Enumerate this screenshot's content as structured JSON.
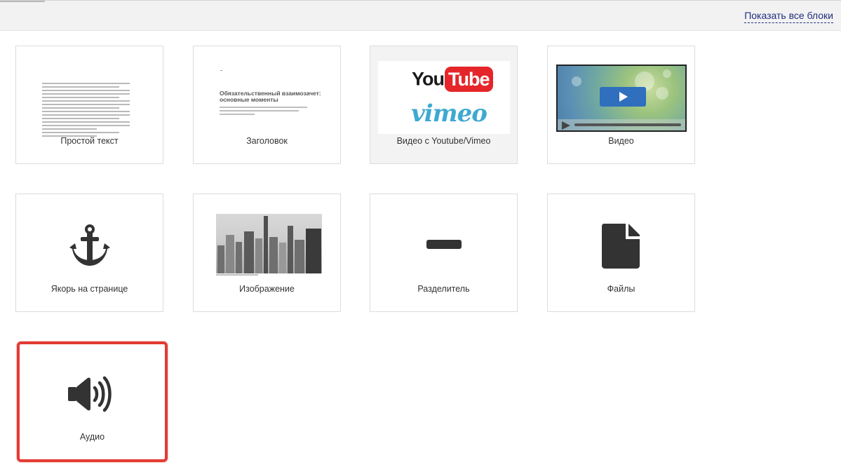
{
  "header": {
    "show_all_label": "Показать все блоки"
  },
  "blocks": [
    {
      "label": "Простой текст",
      "icon": "text-preview-icon"
    },
    {
      "label": "Заголовок",
      "icon": "heading-preview-icon"
    },
    {
      "label": "Видео с Youtube/Vimeo",
      "icon": "youtube-vimeo-logo",
      "state": "hovered"
    },
    {
      "label": "Видео",
      "icon": "video-player-preview"
    },
    {
      "label": "Якорь на странице",
      "icon": "anchor-icon"
    },
    {
      "label": "Изображение",
      "icon": "image-preview"
    },
    {
      "label": "Разделитель",
      "icon": "divider-icon"
    },
    {
      "label": "Файлы",
      "icon": "file-icon"
    },
    {
      "label": "Аудио",
      "icon": "speaker-icon",
      "state": "selected"
    }
  ],
  "previews": {
    "heading_title": "Обязательственный взаимозачет: основные моменты",
    "youtube_you": "You",
    "youtube_tube": "Tube",
    "vimeo": "vimeo"
  },
  "colors": {
    "accent_link": "#1f2f7f",
    "selection_border": "#e33b33",
    "youtube_red": "#e4262a",
    "vimeo_blue": "#3fa9d1",
    "icon_dark": "#333333"
  }
}
